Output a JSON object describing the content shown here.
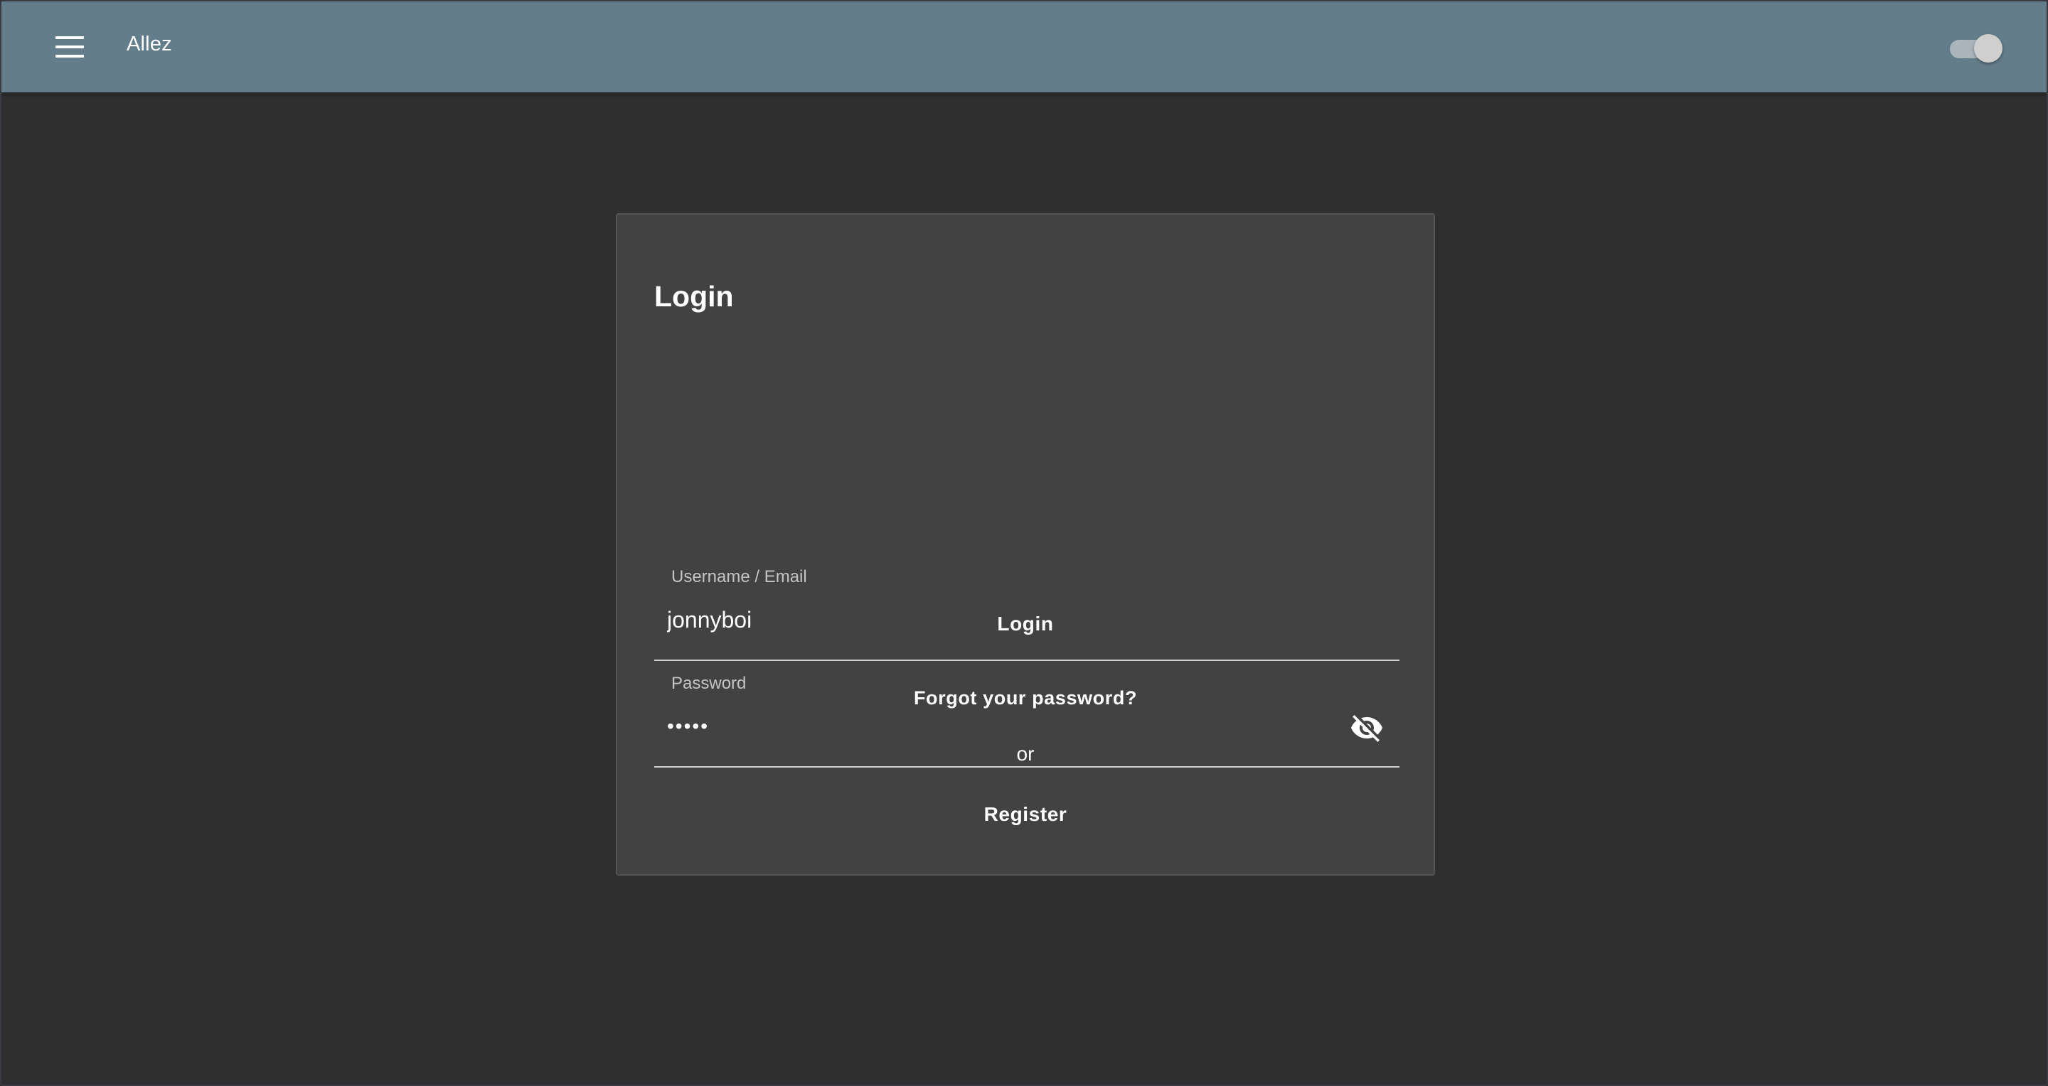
{
  "app_bar": {
    "title": "Allez",
    "menu_icon": "menu-icon",
    "theme_toggle_on": true
  },
  "login_form": {
    "title": "Login",
    "username": {
      "label": "Username / Email",
      "value": "jonnyboi"
    },
    "password": {
      "label": "Password",
      "value": "•••••",
      "visibility_icon": "visibility-off-icon"
    },
    "login_label": "Login",
    "forgot_label": "Forgot your password?",
    "or_label": "or",
    "register_label": "Register"
  },
  "colors": {
    "app_bar": "#647d8a",
    "background": "#2f2f2f",
    "card": "#424242",
    "text": "#ffffff"
  }
}
